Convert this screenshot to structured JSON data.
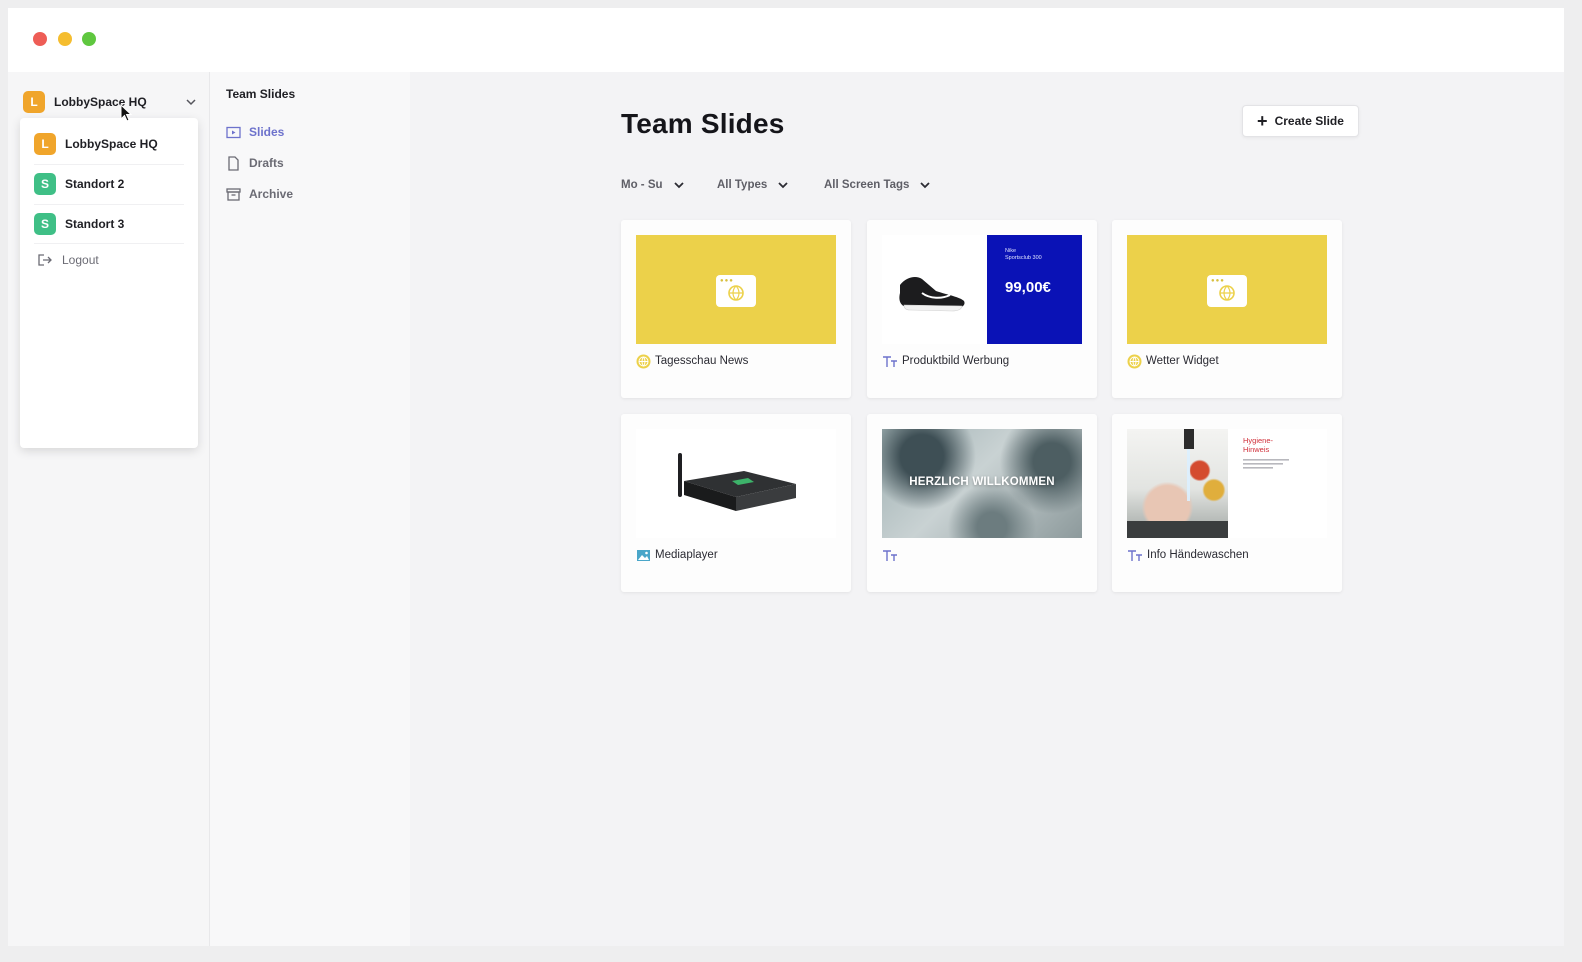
{
  "team_switcher": {
    "current_initial": "L",
    "current_name": "LobbySpace HQ",
    "items": [
      {
        "initial": "L",
        "name": "LobbySpace HQ",
        "color": "#f0a52b"
      },
      {
        "initial": "S",
        "name": "Standort 2",
        "color": "#3fbf86"
      },
      {
        "initial": "S",
        "name": "Standort 3",
        "color": "#3fbf86"
      }
    ],
    "logout_label": "Logout"
  },
  "nav": {
    "title": "Team Slides",
    "items": [
      {
        "label": "Slides",
        "icon": "slides-icon",
        "active": true
      },
      {
        "label": "Drafts",
        "icon": "document-icon",
        "active": false
      },
      {
        "label": "Archive",
        "icon": "archive-icon",
        "active": false
      }
    ]
  },
  "main": {
    "title": "Team Slides",
    "create_label": "Create Slide",
    "filters": [
      {
        "label": "Mo - Su"
      },
      {
        "label": "All Types"
      },
      {
        "label": "All Screen Tags"
      }
    ],
    "cards": [
      {
        "title": "Tagesschau News",
        "type_icon": "web-icon"
      },
      {
        "title": "Produktbild Werbung",
        "type_icon": "text-icon",
        "ad_text": "Nike\nSportsclub 300",
        "price": "99,00€"
      },
      {
        "title": "Wetter Widget",
        "type_icon": "web-icon"
      },
      {
        "title": "Mediaplayer",
        "type_icon": "image-icon"
      },
      {
        "title": "",
        "type_icon": "text-icon",
        "overlay_text": "HERZLICH WILLKOMMEN"
      },
      {
        "title": "Info Händewaschen",
        "type_icon": "text-icon",
        "poster_title": "Hygiene-\nHinweis"
      }
    ]
  },
  "colors": {
    "accent": "#6d72cc",
    "yellow_thumb": "#ecd14a",
    "blue_ad": "#0a12b6"
  }
}
